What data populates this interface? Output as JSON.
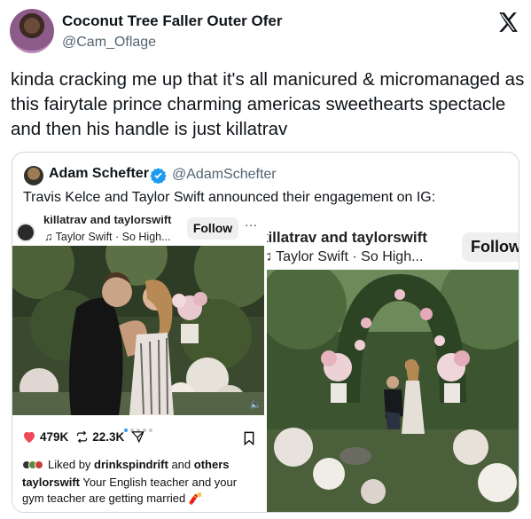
{
  "tweet": {
    "display_name": "Coconut Tree Faller Outer Ofer",
    "handle": "@Cam_Oflage",
    "text": "kinda cracking me up that it's all manicured & micromanaged as this fairytale prince charming americas sweethearts spectacle and then his handle is just killatrav"
  },
  "quote": {
    "display_name": "Adam Schefter",
    "handle": "@AdamSchefter",
    "text": "Travis Kelce and Taylor Swift announced their engagement on IG:",
    "verified_color": "#1d9bf0"
  },
  "instagram_left": {
    "user": "killatrav and taylorswift",
    "song": "Taylor Swift · So High...",
    "follow_label": "Follow",
    "more_label": "···",
    "likes": "479K",
    "reposts": "22.3K",
    "liked_by_prefix": "Liked by ",
    "liked_by_user": "drinkspindrift",
    "liked_by_mid": " and ",
    "liked_by_others": "others",
    "caption_user": "taylorswift",
    "caption_text": " Your English teacher and your gym teacher are getting married"
  },
  "instagram_right": {
    "user": "killatrav and taylorswift",
    "song": "Taylor Swift · So High...",
    "follow_label": "Follow"
  },
  "icons": {
    "x_logo": "x-logo-icon",
    "heart": "heart-icon",
    "repost": "repost-icon",
    "share": "send-icon",
    "bookmark": "bookmark-icon"
  },
  "colors": {
    "heart": "#ed4956",
    "text_secondary": "#536471",
    "border": "#cfd9de"
  }
}
